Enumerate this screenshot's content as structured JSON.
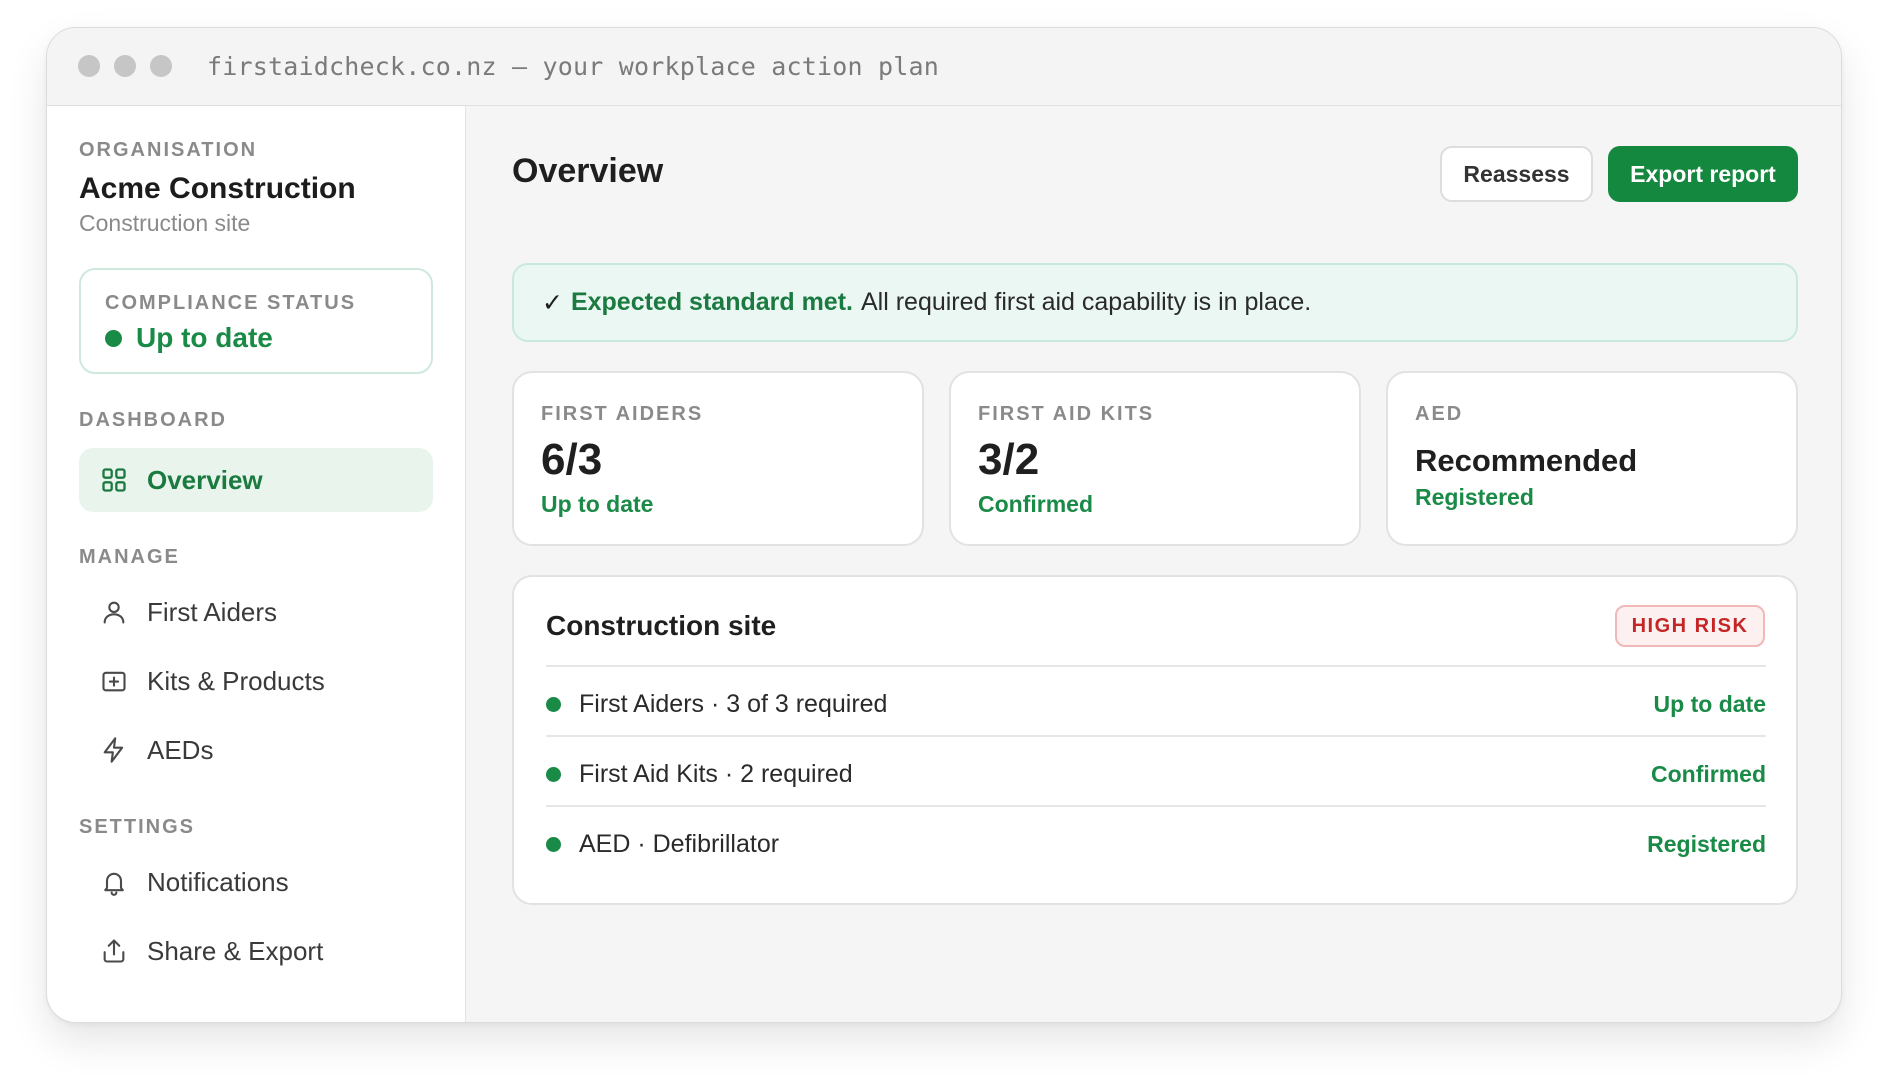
{
  "browser": {
    "url_bar": "firstaidcheck.co.nz — your workplace action plan"
  },
  "sidebar": {
    "org_label": "ORGANISATION",
    "org_name": "Acme Construction",
    "org_type": "Construction site",
    "compliance": {
      "label": "COMPLIANCE STATUS",
      "value": "Up to date",
      "color": "#1a8a47"
    },
    "sections": [
      {
        "title": "DASHBOARD",
        "items": [
          {
            "label": "Overview",
            "icon": "grid-icon",
            "active": true
          }
        ]
      },
      {
        "title": "MANAGE",
        "items": [
          {
            "label": "First Aiders",
            "icon": "person-icon"
          },
          {
            "label": "Kits & Products",
            "icon": "first-aid-box-icon"
          },
          {
            "label": "AEDs",
            "icon": "lightning-icon"
          }
        ]
      },
      {
        "title": "SETTINGS",
        "items": [
          {
            "label": "Notifications",
            "icon": "bell-icon"
          },
          {
            "label": "Share & Export",
            "icon": "share-upload-icon"
          }
        ]
      }
    ]
  },
  "main": {
    "title": "Overview",
    "actions": {
      "reassess": "Reassess",
      "export": "Export report"
    },
    "banner": {
      "check": "✓",
      "strong": "Expected standard met.",
      "text": "All required first aid capability is in place."
    },
    "stats": [
      {
        "label": "FIRST AIDERS",
        "value": "6/3",
        "status": "Up to date"
      },
      {
        "label": "FIRST AID KITS",
        "value": "3/2",
        "status": "Confirmed"
      },
      {
        "label": "AED",
        "value": "Recommended",
        "status": "Registered"
      }
    ],
    "site": {
      "title": "Construction site",
      "risk_badge": "HIGH RISK",
      "rows": [
        {
          "text": "First Aiders · 3 of 3 required",
          "status": "Up to date"
        },
        {
          "text": "First Aid Kits · 2 required",
          "status": "Confirmed"
        },
        {
          "text": "AED · Defibrillator",
          "status": "Registered"
        }
      ]
    }
  },
  "colors": {
    "accent_green": "#15883f",
    "status_green": "#1a8a47",
    "risk_red": "#c42626"
  }
}
